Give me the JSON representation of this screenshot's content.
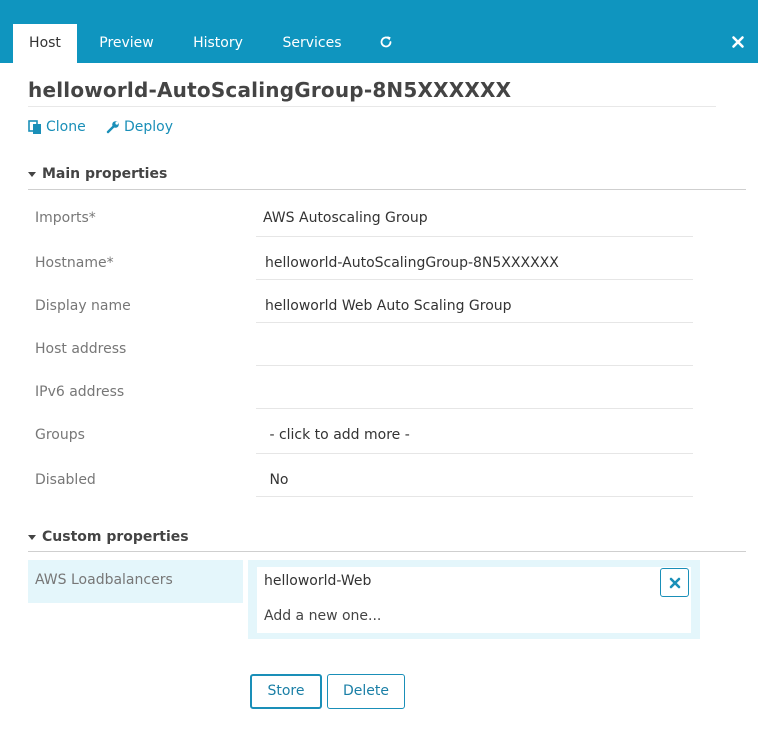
{
  "tabs": [
    {
      "label": "Host"
    },
    {
      "label": "Preview"
    },
    {
      "label": "History"
    },
    {
      "label": "Services"
    }
  ],
  "header": {
    "title": "helloworld-AutoScalingGroup-8N5XXXXXX"
  },
  "actions": {
    "clone_label": "Clone",
    "deploy_label": "Deploy"
  },
  "main_properties": {
    "section_title": "Main properties",
    "rows": [
      {
        "label": "Imports*",
        "value": "AWS Autoscaling Group"
      },
      {
        "label": "Hostname*",
        "value": "helloworld-AutoScalingGroup-8N5XXXXXX"
      },
      {
        "label": "Display name",
        "value": "helloworld Web Auto Scaling Group"
      },
      {
        "label": "Host address",
        "value": ""
      },
      {
        "label": "IPv6 address",
        "value": ""
      },
      {
        "label": "Groups",
        "value": " - click to add more -"
      },
      {
        "label": "Disabled",
        "value": " No"
      }
    ]
  },
  "custom_properties": {
    "section_title": "Custom properties",
    "label": "AWS Loadbalancers",
    "item_value": "helloworld-Web",
    "add_placeholder": "Add a new one..."
  },
  "buttons": {
    "store_label": "Store",
    "delete_label": "Delete"
  },
  "colors": {
    "header": "#0f95bf",
    "accent": "#1a8fb8",
    "highlight": "#e4f6fb"
  },
  "icons": {
    "refresh": "refresh-icon",
    "close": "close-icon",
    "clone": "copy-icon",
    "deploy": "wrench-icon",
    "remove": "close-icon"
  }
}
